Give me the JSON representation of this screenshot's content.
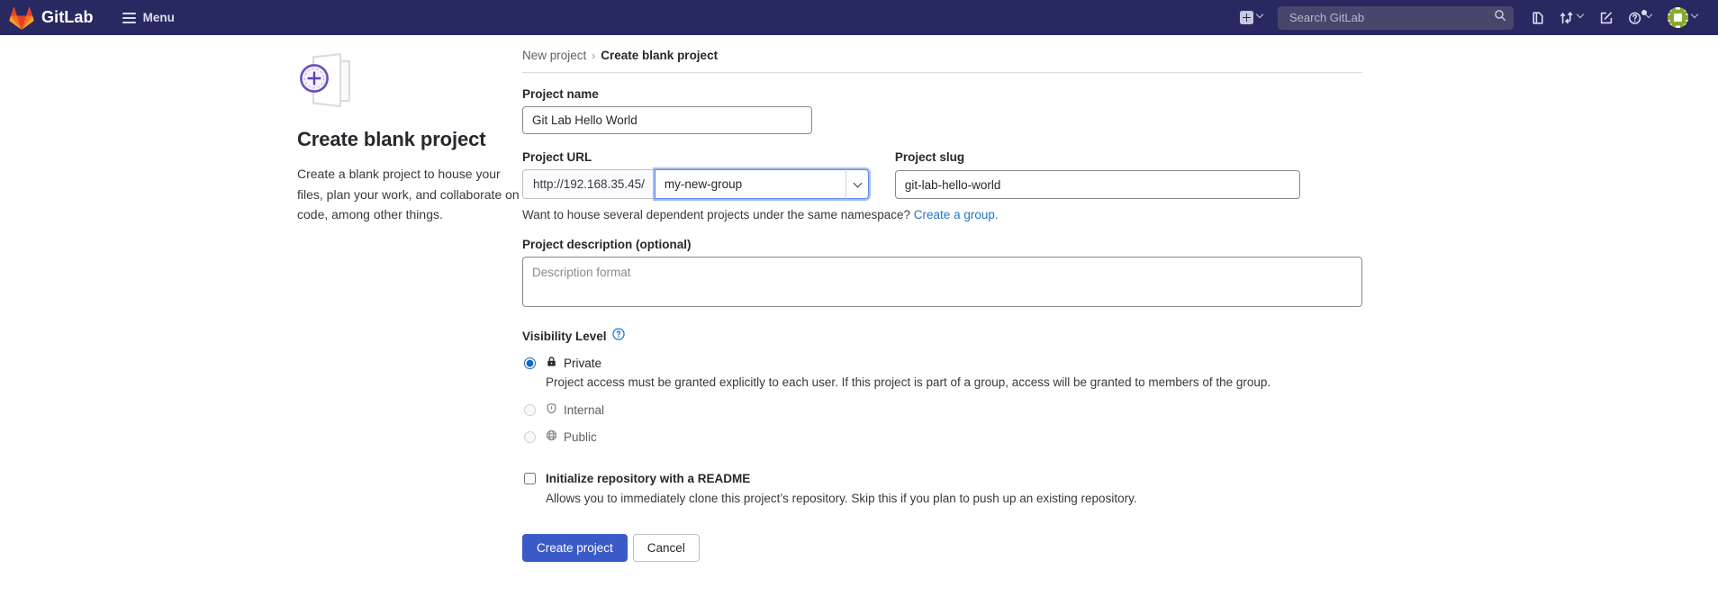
{
  "navbar": {
    "brand": "GitLab",
    "menu_label": "Menu",
    "new_dropdown_icon": "plus-square-icon",
    "search_placeholder": "Search GitLab",
    "search_value": "",
    "icons": [
      {
        "name": "issues-icon",
        "label": "Issues"
      },
      {
        "name": "merge-requests-icon",
        "label": "Merge requests"
      },
      {
        "name": "todos-icon",
        "label": "To-Do List"
      },
      {
        "name": "help-icon",
        "label": "Help"
      },
      {
        "name": "user-avatar",
        "label": "User menu"
      }
    ],
    "background_color": "#292961"
  },
  "left_panel": {
    "illustration": "blank-project-illustration",
    "title": "Create blank project",
    "description": "Create a blank project to house your files, plan your work, and collaborate on code, among other things."
  },
  "breadcrumb": {
    "parent": "New project",
    "separator": "›",
    "current": "Create blank project"
  },
  "form": {
    "project_name": {
      "label": "Project name",
      "value": "Git Lab Hello World",
      "placeholder": ""
    },
    "project_url": {
      "label": "Project URL",
      "prefix": "http://192.168.35.45/",
      "selected_group": "my-new-group",
      "options": [
        "my-new-group"
      ]
    },
    "project_slug": {
      "label": "Project slug",
      "value": "git-lab-hello-world",
      "placeholder": ""
    },
    "namespace_hint": {
      "text": "Want to house several dependent projects under the same namespace?",
      "link_text": "Create a group."
    },
    "description": {
      "label": "Project description (optional)",
      "value": "",
      "placeholder": "Description format"
    },
    "visibility": {
      "label": "Visibility Level",
      "help_icon": "question-circle-icon",
      "selected": "private",
      "options": [
        {
          "id": "private",
          "icon": "lock-icon",
          "label": "Private",
          "description": "Project access must be granted explicitly to each user. If this project is part of a group, access will be granted to members of the group.",
          "disabled": false,
          "checked": true
        },
        {
          "id": "internal",
          "icon": "shield-icon",
          "label": "Internal",
          "description": "",
          "disabled": true,
          "checked": false
        },
        {
          "id": "public",
          "icon": "globe-icon",
          "label": "Public",
          "description": "",
          "disabled": true,
          "checked": false
        }
      ]
    },
    "readme": {
      "label": "Initialize repository with a README",
      "description": "Allows you to immediately clone this project’s repository. Skip this if you plan to push up an existing repository.",
      "checked": false
    },
    "actions": {
      "submit_label": "Create project",
      "cancel_label": "Cancel"
    }
  },
  "colors": {
    "navbar_bg": "#292961",
    "primary_button": "#3a5bc7",
    "link": "#1f75cb",
    "focus_ring": "#a3bdf5"
  }
}
